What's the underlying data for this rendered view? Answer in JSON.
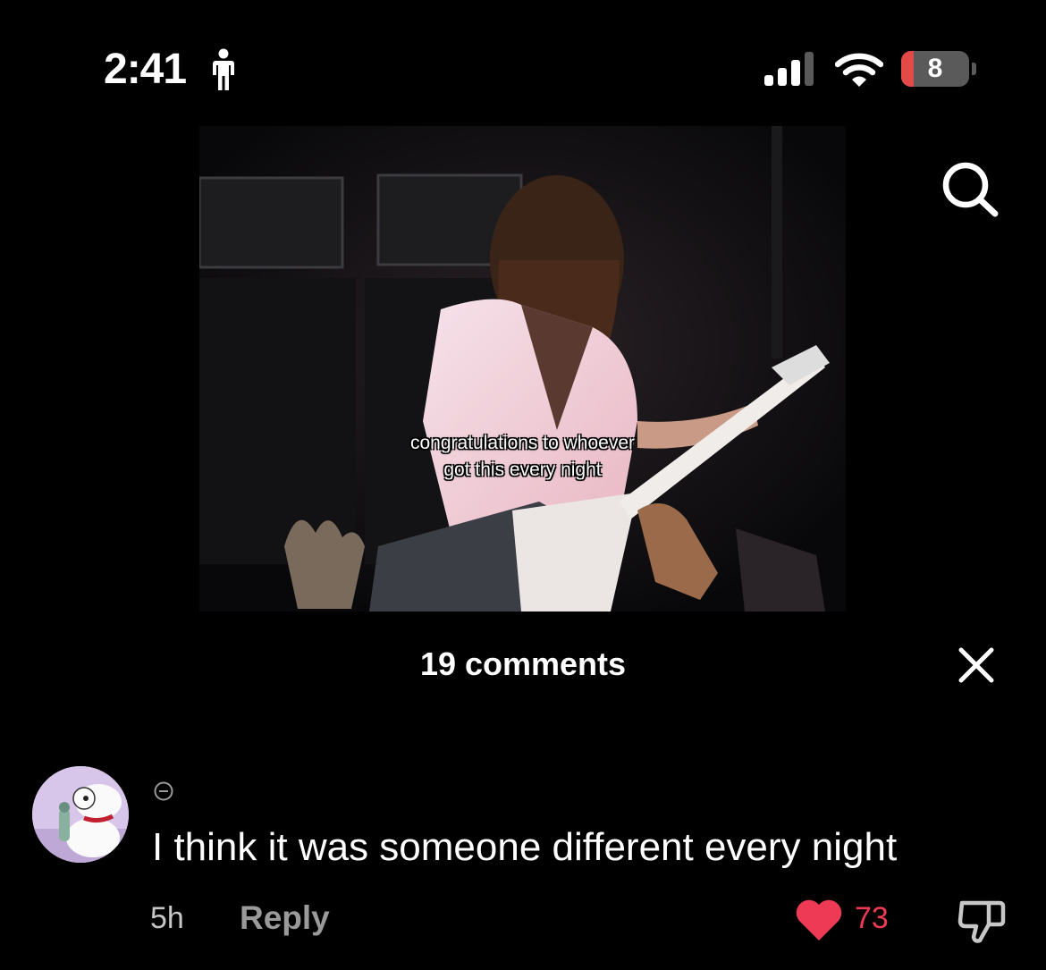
{
  "status_bar": {
    "time": "2:41",
    "battery_level": "8",
    "battery_fraction": 0.08,
    "icons": [
      "person-icon",
      "signal-icon",
      "wifi-icon",
      "battery-icon"
    ]
  },
  "video": {
    "caption_line1": "congratulations to whoever",
    "caption_line2": "got this every night"
  },
  "header": {
    "comments_label": "19 comments",
    "search_icon": "search-icon",
    "close_icon": "close-icon"
  },
  "comment": {
    "text": "I think it was someone different every night",
    "time": "5h",
    "reply_label": "Reply",
    "likes": "73",
    "icons": [
      "avatar",
      "collapse-icon",
      "heart-icon",
      "dislike-icon"
    ]
  },
  "colors": {
    "background": "#000000",
    "like_red": "#ee3a55",
    "battery_red": "#e24a48",
    "muted_text": "#9a9a9a"
  }
}
